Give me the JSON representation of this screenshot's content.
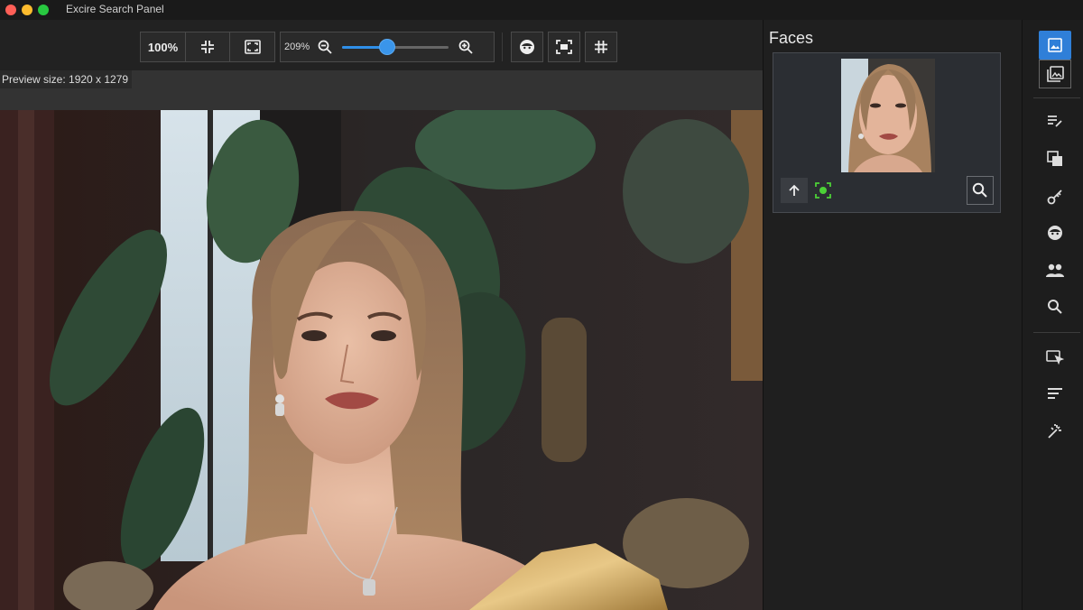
{
  "window": {
    "title": "Excire Search Panel"
  },
  "toolbar": {
    "zoom_100_label": "100%",
    "zoom_value": "209%",
    "zoom_level": 0.42
  },
  "preview": {
    "size_text": "Preview size: 1920 x 1279"
  },
  "faces": {
    "title": "Faces"
  },
  "icons": {
    "fit": "compress-arrows-icon",
    "fill": "fullscreen-frame-icon",
    "zoom_out": "zoom-out-icon",
    "zoom_in": "zoom-in-icon",
    "face": "face-icon",
    "focus": "focus-frame-icon",
    "grid": "hash-grid-icon"
  },
  "colors": {
    "accent": "#2f8fe8",
    "face_detect": "#4cd137"
  }
}
